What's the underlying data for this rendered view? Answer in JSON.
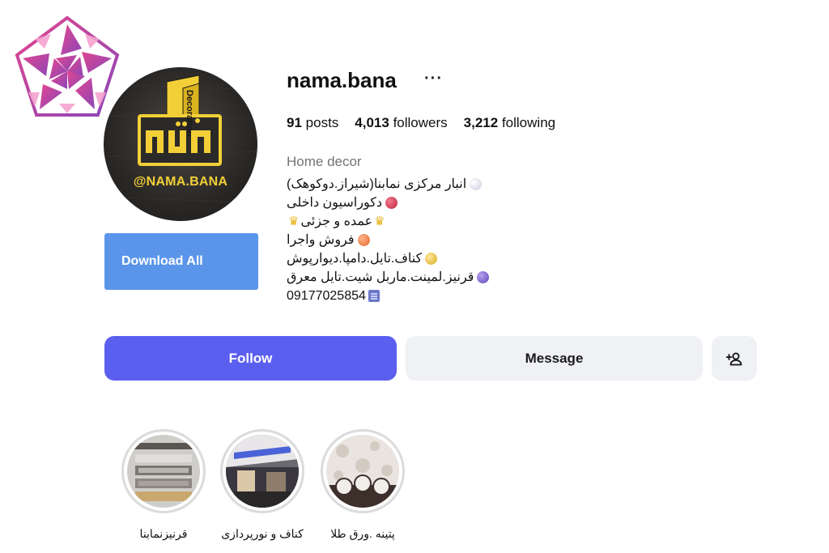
{
  "profile": {
    "username": "nama.bana",
    "more_label": "···",
    "avatar_handle": "@NAMA.BANA",
    "avatar_text": "Decoration",
    "download_label": "Download All",
    "stats": {
      "posts_count": "91",
      "posts_label": "posts",
      "followers_count": "4,013",
      "followers_label": "followers",
      "following_count": "3,212",
      "following_label": "following"
    },
    "category": "Home decor",
    "bio": [
      {
        "text": "انبار مرکزی نمابنا(شیراز.دوکوهک)",
        "icon": "pearl-dot",
        "color": "#e7e3f1"
      },
      {
        "text": "دکوراسیون داخلی",
        "icon": "red-dot",
        "color": "#d0314f"
      },
      {
        "text": "عمده و جزئی",
        "icon": "crown-icon",
        "color": "#e7b21a"
      },
      {
        "text": "فروش واجرا",
        "icon": "orange-dot",
        "color": "#ee7a3c"
      },
      {
        "text": "کناف.تایل.دامپا.دیوارپوش",
        "icon": "yellow-dot",
        "color": "#e6c23a"
      },
      {
        "text": "قرنیز.لمینت.ماربل شیت.تایل معرق",
        "icon": "purple-dot",
        "color": "#7b62c9"
      },
      {
        "text": "09177025854",
        "icon": "phone-icon",
        "color": "#5a6bd6"
      }
    ]
  },
  "actions": {
    "follow_label": "Follow",
    "message_label": "Message"
  },
  "highlights": [
    {
      "label": "قرنیزنمابنا",
      "icon": "highlight-image"
    },
    {
      "label": "کناف و نورپردازی",
      "icon": "highlight-image"
    },
    {
      "label": "پتینه .ورق طلا",
      "icon": "highlight-image"
    }
  ],
  "colors": {
    "follow_bg": "#5b5fef",
    "download_bg": "#5b95ea",
    "secondary_bg": "#eff1f5",
    "avatar_gold": "#f2cf37"
  }
}
